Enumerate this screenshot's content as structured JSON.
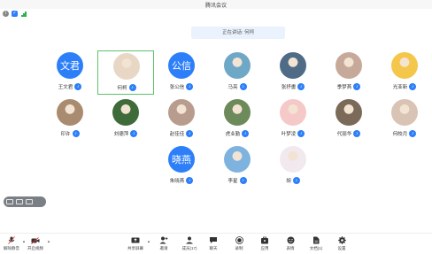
{
  "window": {
    "title": "腾讯会议"
  },
  "banner": {
    "text": "正在讲话: 何柯"
  },
  "participants": [
    {
      "name": "王文君",
      "avatar_text": "文君",
      "avatar_color": "#2d7ff9",
      "photo": false,
      "active": false
    },
    {
      "name": "何柯",
      "avatar_text": "",
      "avatar_color": "#e8d7c4",
      "photo": true,
      "active": true
    },
    {
      "name": "张公信",
      "avatar_text": "公信",
      "avatar_color": "#2d7ff9",
      "photo": false,
      "active": false
    },
    {
      "name": "马亮",
      "avatar_text": "",
      "avatar_color": "#6fa7c7",
      "photo": true,
      "active": false
    },
    {
      "name": "张抒畫",
      "avatar_text": "",
      "avatar_color": "#4f6b86",
      "photo": true,
      "active": false
    },
    {
      "name": "季梦燕",
      "avatar_text": "",
      "avatar_color": "#c7a99a",
      "photo": true,
      "active": false
    },
    {
      "name": "光亚新",
      "avatar_text": "",
      "avatar_color": "#f4c64a",
      "photo": true,
      "active": false
    },
    {
      "name": "印许",
      "avatar_text": "",
      "avatar_color": "#a98b6f",
      "photo": true,
      "active": false
    },
    {
      "name": "刘德萍",
      "avatar_text": "",
      "avatar_color": "#3f6b3a",
      "photo": true,
      "active": false
    },
    {
      "name": "赵佳佳",
      "avatar_text": "",
      "avatar_color": "#b89c8d",
      "photo": true,
      "active": false
    },
    {
      "name": "虎业勤",
      "avatar_text": "",
      "avatar_color": "#6d8a5a",
      "photo": true,
      "active": false
    },
    {
      "name": "叶梦凌",
      "avatar_text": "",
      "avatar_color": "#f6c9c9",
      "photo": true,
      "active": false
    },
    {
      "name": "代丽华",
      "avatar_text": "",
      "avatar_color": "#7b6a58",
      "photo": true,
      "active": false
    },
    {
      "name": "何皎月",
      "avatar_text": "",
      "avatar_color": "#d9c3b4",
      "photo": true,
      "active": false
    },
    {
      "name": "朱晓燕",
      "avatar_text": "晓燕",
      "avatar_color": "#2d7ff9",
      "photo": false,
      "active": false
    },
    {
      "name": "李星",
      "avatar_text": "",
      "avatar_color": "#7fb3df",
      "photo": true,
      "active": false
    },
    {
      "name": "胡",
      "avatar_text": "",
      "avatar_color": "#f2e9ef",
      "photo": true,
      "active": false
    }
  ],
  "toolbar": {
    "mute": "解除静音",
    "video": "开启视频",
    "share": "共享屏幕",
    "invite": "邀请",
    "members": "成员(17)",
    "chat": "聊天",
    "record": "录制",
    "apps": "应用",
    "reactions": "表情",
    "docs": "文档(1)",
    "settings": "设置"
  },
  "colors": {
    "accent": "#2d7ff9",
    "active_border": "#5cc36a"
  }
}
